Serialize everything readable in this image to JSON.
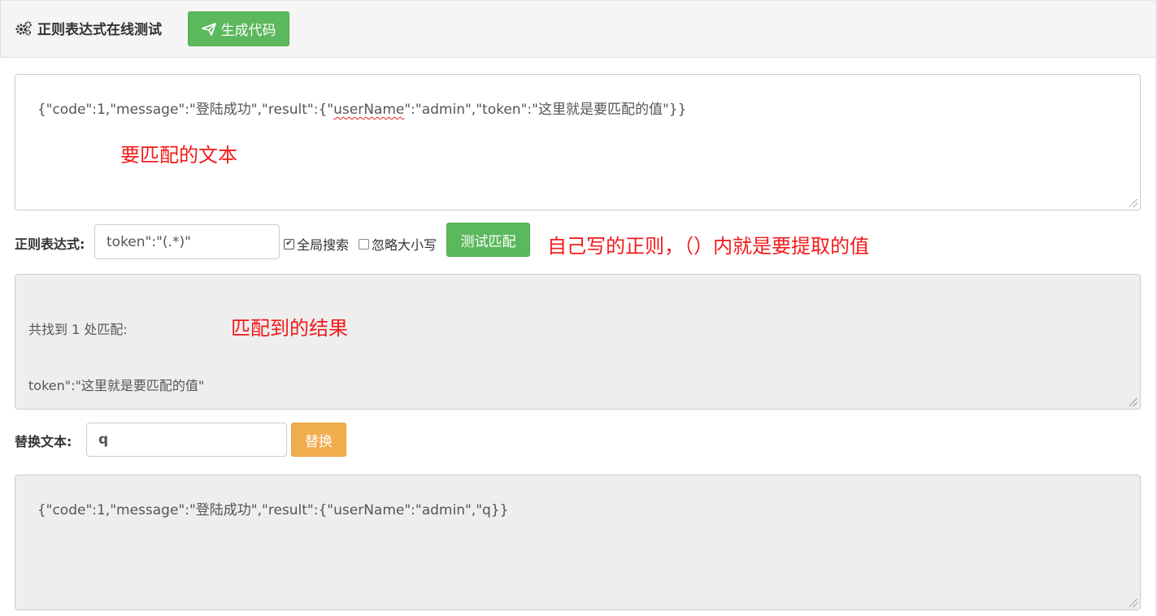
{
  "header": {
    "title": "正则表达式在线测试",
    "generate_button": "生成代码"
  },
  "input_text": {
    "before_underline": "{\"code\":1,\"message\":\"登陆成功\",\"result\":{\"",
    "underlined": "userName",
    "after_underline": "\":\"admin\",\"token\":\"这里就是要匹配的值\"}}"
  },
  "regex": {
    "label": "正则表达式:",
    "value": "token\":\"(.*)\"",
    "global_search_label": "全局搜索",
    "global_search_checked": true,
    "ignore_case_label": "忽略大小写",
    "ignore_case_checked": false,
    "test_button": "测试匹配"
  },
  "match_result": {
    "line1": "共找到 1 处匹配:",
    "line2": "token\":\"这里就是要匹配的值\""
  },
  "replace": {
    "label": "替换文本:",
    "value": "q",
    "button": "替换"
  },
  "replaced_text": "{\"code\":1,\"message\":\"登陆成功\",\"result\":{\"userName\":\"admin\",\"q}}",
  "annotations": {
    "text_to_match": "要匹配的文本",
    "regex_note": "自己写的正则，（）内就是要提取的值",
    "result_note": "匹配到的结果"
  },
  "colors": {
    "accent_green": "#5cb85c",
    "accent_orange": "#f0ad4e",
    "annotation_red": "#f21a1a"
  }
}
